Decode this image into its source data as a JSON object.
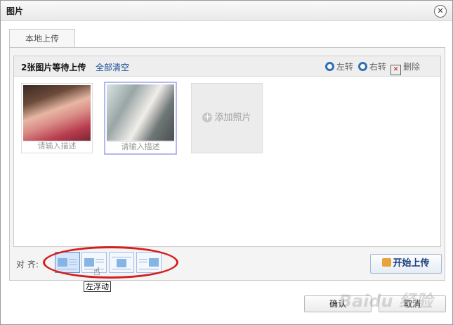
{
  "window": {
    "title": "图片",
    "close_glyph": "✕"
  },
  "tabs": [
    {
      "label": "本地上传",
      "active": true
    }
  ],
  "toolbar": {
    "pending_text": "2张图片等待上传",
    "clear_all": "全部清空",
    "rotate_left": "左转",
    "rotate_right": "右转",
    "delete": "删除"
  },
  "images": [
    {
      "description_placeholder": "请输入描述",
      "selected": false
    },
    {
      "description_placeholder": "请输入描述",
      "selected": true
    }
  ],
  "add_photo": {
    "plus": "+",
    "label": "添加照片"
  },
  "align": {
    "label": "对 齐:",
    "tooltip": "左浮动",
    "options": [
      "float-left-icon",
      "float-left-icon",
      "center-icon",
      "float-right-icon"
    ]
  },
  "start_upload": {
    "label": "开始上传"
  },
  "footer": {
    "confirm": "确认",
    "cancel": "取消"
  },
  "watermark": "Baidu 经验",
  "colors": {
    "accent": "#1d4f9a",
    "highlight_oval": "#d61e1e"
  }
}
